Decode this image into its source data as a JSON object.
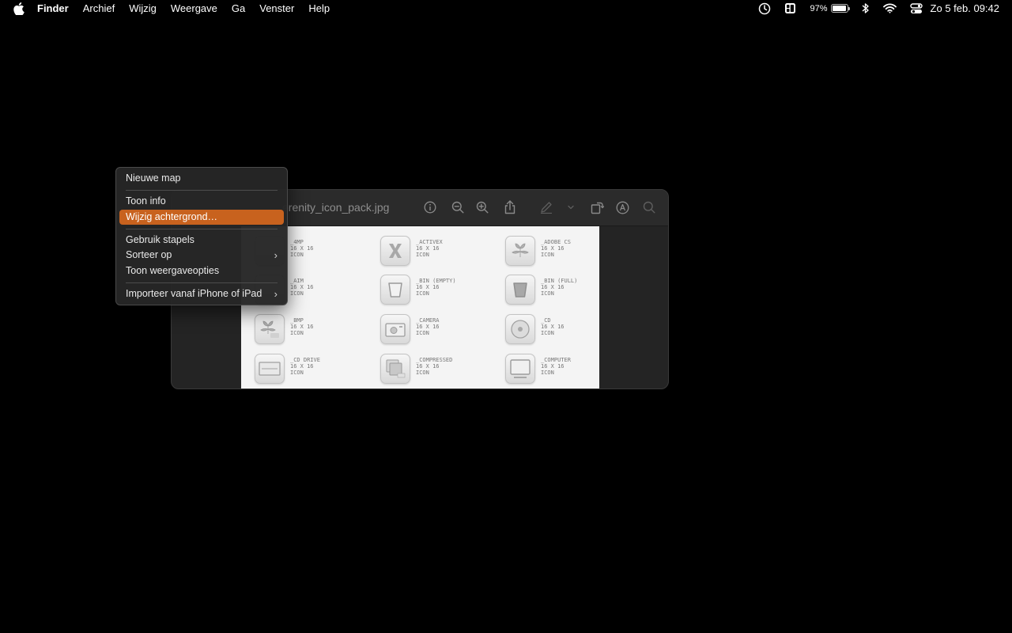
{
  "menubar": {
    "app": "Finder",
    "items": [
      "Archief",
      "Wijzig",
      "Weergave",
      "Ga",
      "Venster",
      "Help"
    ],
    "status": {
      "battery_percent": "97%",
      "battery_level": 0.97,
      "datetime": "Zo 5 feb.  09:42"
    }
  },
  "window": {
    "title": "erenity_icon_pack.jpg"
  },
  "icon_pack": [
    {
      "name": "_4MP",
      "size": "16 x 16",
      "type": "ICON"
    },
    {
      "name": "_ACTIVEX",
      "size": "16 x 16",
      "type": "ICON"
    },
    {
      "name": "_ADOBE CS",
      "size": "16 x 16",
      "type": "ICON"
    },
    {
      "name": "_AIM",
      "size": "16 x 16",
      "type": "ICON"
    },
    {
      "name": "_BIN (EMPTY)",
      "size": "16 x 16",
      "type": "ICON"
    },
    {
      "name": "_BIN (FULL)",
      "size": "16 x 16",
      "type": "ICON"
    },
    {
      "name": "_BMP",
      "size": "16 x 16",
      "type": "ICON"
    },
    {
      "name": "_CAMERA",
      "size": "16 x 16",
      "type": "ICON"
    },
    {
      "name": "_CD",
      "size": "16 x 16",
      "type": "ICON"
    },
    {
      "name": "_CD DRIVE",
      "size": "16 x 16",
      "type": "ICON"
    },
    {
      "name": "_COMPRESSED",
      "size": "16 x 16",
      "type": "ICON"
    },
    {
      "name": "_COMPUTER",
      "size": "16 x 16",
      "type": "ICON"
    }
  ],
  "context_menu": {
    "new_folder": "Nieuwe map",
    "get_info": "Toon info",
    "change_background": "Wijzig achtergrond…",
    "use_stacks": "Gebruik stapels",
    "sort_by": "Sorteer op",
    "view_options": "Toon weergaveopties",
    "import_from_iphone": "Importeer vanaf iPhone of iPad"
  },
  "icons": {
    "apple": "apple-logo-icon",
    "time_machine": "clock-icon",
    "stage_manager": "stage-manager-icon",
    "battery": "battery-icon",
    "bluetooth": "bluetooth-icon",
    "wifi": "wifi-icon",
    "control_center": "control-center-icon"
  }
}
